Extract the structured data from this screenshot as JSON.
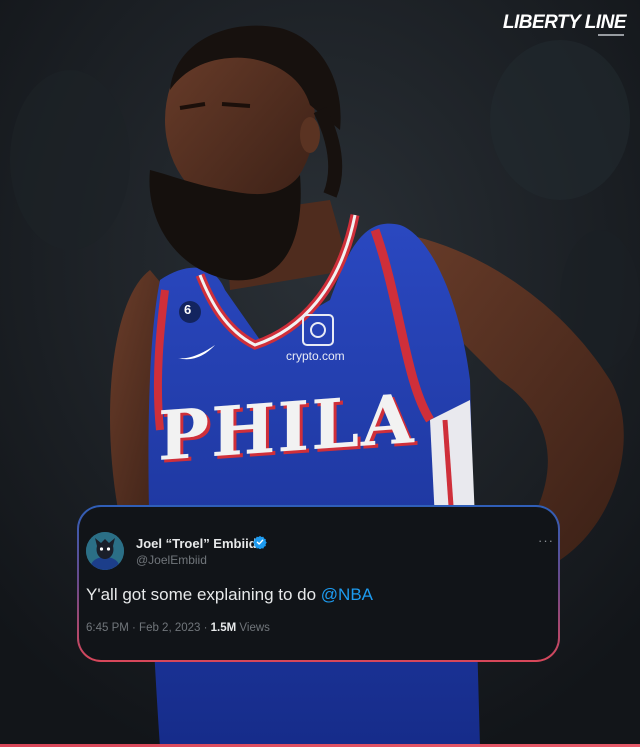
{
  "brand": {
    "name": "LIBERTY LINE"
  },
  "photo": {
    "jersey_text": "PHILA",
    "jersey_number": "6",
    "sponsor": "crypto.com"
  },
  "tweet": {
    "display_name": "Joel “Troel” Embiid",
    "handle": "@JoelEmbiid",
    "text_main": "Y'all got some explaining to do ",
    "mention": "@NBA",
    "timestamp": "6:45 PM · Feb 2, 2023 · ",
    "views_count": "1.5M",
    "views_label": " Views",
    "more_label": "···",
    "verified_icon": "verified-badge-icon"
  },
  "colors": {
    "accent_blue": "#1d9bf0",
    "jersey_blue": "#1f3aa8",
    "jersey_red": "#cf2f3a",
    "card_border_top": "#2f5fb8",
    "card_border_bottom": "#d8475a"
  }
}
